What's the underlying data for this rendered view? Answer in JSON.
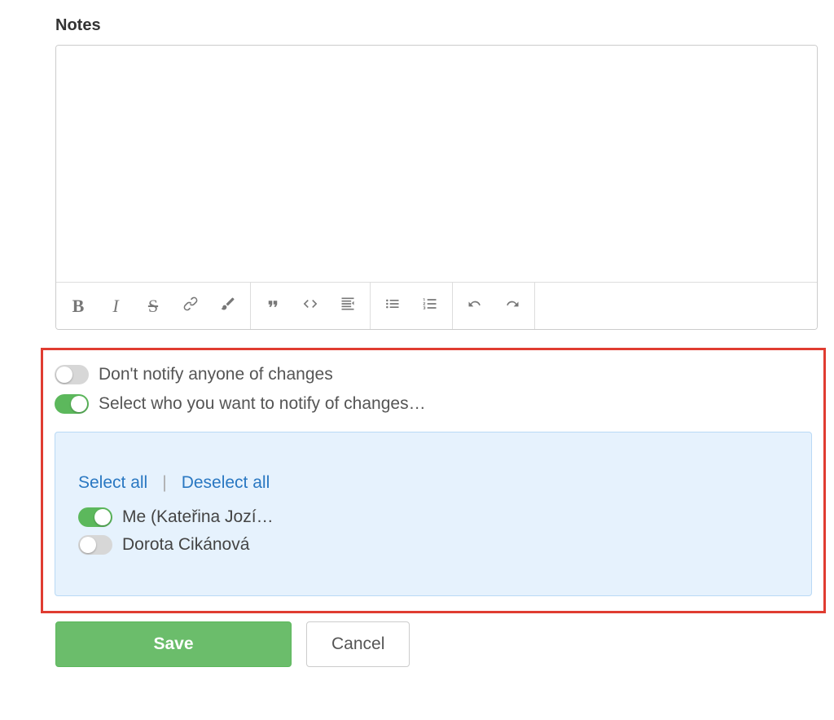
{
  "notes": {
    "label": "Notes",
    "value": ""
  },
  "notify": {
    "dont_notify_label": "Don't notify anyone of changes",
    "dont_notify_on": false,
    "select_who_label": "Select who you want to notify of changes…",
    "select_who_on": true,
    "select_all": "Select all",
    "deselect_all": "Deselect all",
    "people": [
      {
        "label": "Me (Kateřina Jozí…",
        "on": true
      },
      {
        "label": "Dorota Cikánová",
        "on": false
      }
    ]
  },
  "buttons": {
    "save": "Save",
    "cancel": "Cancel"
  }
}
